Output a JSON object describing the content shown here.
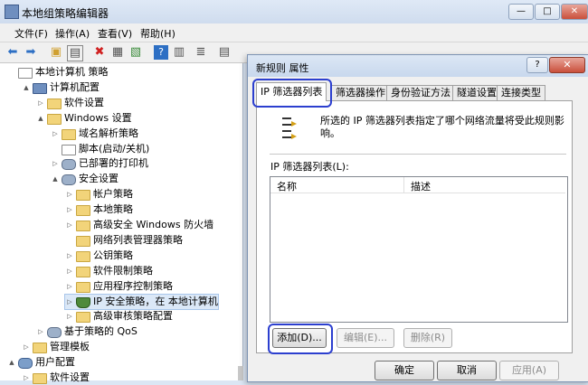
{
  "window": {
    "title": "本地组策略编辑器",
    "controls": [
      "—",
      "□",
      "✕"
    ]
  },
  "menu": [
    "文件(F)",
    "操作(A)",
    "查看(V)",
    "帮助(H)"
  ],
  "toolbar_icons": [
    "back-arrow-icon",
    "forward-arrow-icon",
    "up-folder-icon",
    "show-tree-icon",
    "delete-icon",
    "properties-icon",
    "export-icon",
    "help-icon",
    "view-icon",
    "filter-icon",
    "script-icon"
  ],
  "tree": [
    {
      "label": "本地计算机 策略",
      "depth": 0,
      "icon": "doc",
      "toggle": ""
    },
    {
      "label": "计算机配置",
      "depth": 1,
      "icon": "comp",
      "toggle": "▲"
    },
    {
      "label": "软件设置",
      "depth": 2,
      "icon": "folder",
      "toggle": "▷"
    },
    {
      "label": "Windows 设置",
      "depth": 2,
      "icon": "folder",
      "toggle": "▲"
    },
    {
      "label": "域名解析策略",
      "depth": 3,
      "icon": "folder",
      "toggle": "▷"
    },
    {
      "label": "脚本(启动/关机)",
      "depth": 3,
      "icon": "doc",
      "toggle": ""
    },
    {
      "label": "已部署的打印机",
      "depth": 3,
      "icon": "gear",
      "toggle": "▷"
    },
    {
      "label": "安全设置",
      "depth": 3,
      "icon": "gear",
      "toggle": "▲"
    },
    {
      "label": "帐户策略",
      "depth": 4,
      "icon": "lock",
      "toggle": "▷"
    },
    {
      "label": "本地策略",
      "depth": 4,
      "icon": "lock",
      "toggle": "▷"
    },
    {
      "label": "高级安全 Windows 防火墙",
      "depth": 4,
      "icon": "folder",
      "toggle": "▷"
    },
    {
      "label": "网络列表管理器策略",
      "depth": 4,
      "icon": "folder",
      "toggle": ""
    },
    {
      "label": "公钥策略",
      "depth": 4,
      "icon": "folder",
      "toggle": "▷"
    },
    {
      "label": "软件限制策略",
      "depth": 4,
      "icon": "folder",
      "toggle": "▷"
    },
    {
      "label": "应用程序控制策略",
      "depth": 4,
      "icon": "folder",
      "toggle": "▷"
    },
    {
      "label": "IP 安全策略，在 本地计算机",
      "depth": 4,
      "icon": "shield",
      "toggle": "▷",
      "selected": true
    },
    {
      "label": "高级审核策略配置",
      "depth": 4,
      "icon": "folder",
      "toggle": "▷"
    },
    {
      "label": "基于策略的 QoS",
      "depth": 2,
      "icon": "gear",
      "toggle": "▷"
    },
    {
      "label": "管理模板",
      "depth": 1,
      "icon": "folder",
      "toggle": "▷"
    },
    {
      "label": "用户配置",
      "depth": 0,
      "icon": "user",
      "toggle": "▲"
    },
    {
      "label": "软件设置",
      "depth": 1,
      "icon": "folder",
      "toggle": "▷"
    }
  ],
  "dialog": {
    "title": "新规则 属性",
    "help": "?",
    "close": "✕",
    "tabs": [
      "IP 筛选器列表",
      "筛选器操作",
      "身份验证方法",
      "隧道设置",
      "连接类型"
    ],
    "active_tab": 0,
    "description": "所选的 IP 筛选器列表指定了哪个网络流量将受此规则影响。",
    "list_label": "IP 筛选器列表(L):",
    "columns": [
      "名称",
      "描述"
    ],
    "rows": [],
    "buttons": {
      "add": "添加(D)...",
      "edit": "编辑(E)...",
      "delete": "删除(R)",
      "ok": "确定",
      "cancel": "取消",
      "apply": "应用(A)"
    }
  },
  "colors": {
    "highlight_outline": "#2c3fcf",
    "titlebar": "#dfe9f6",
    "close_button": "#c9503b"
  }
}
